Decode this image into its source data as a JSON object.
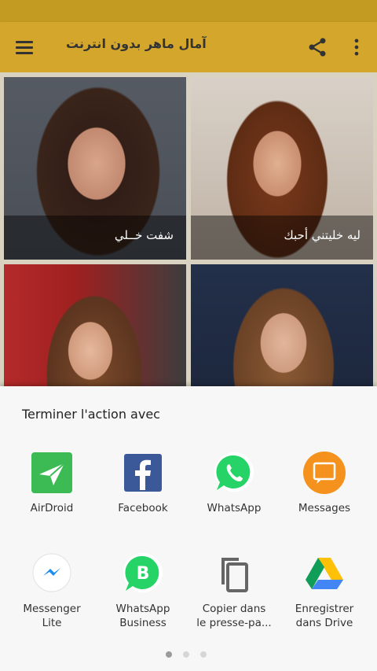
{
  "appbar": {
    "title": "آمال ماهر بدون انترنت",
    "icons": [
      "menu-icon",
      "share-icon",
      "more-vert-icon"
    ],
    "color": "#d4a72c"
  },
  "cards": [
    {
      "caption": "شفت خــلي"
    },
    {
      "caption": "ليه خليتني أحبك"
    },
    {
      "caption": ""
    },
    {
      "caption": ""
    }
  ],
  "share_sheet": {
    "title": "Terminer l'action avec",
    "apps": [
      {
        "label": "AirDroid",
        "icon": "airdroid-icon"
      },
      {
        "label": "Facebook",
        "icon": "facebook-icon"
      },
      {
        "label": "WhatsApp",
        "icon": "whatsapp-icon"
      },
      {
        "label": "Messages",
        "icon": "messages-icon"
      },
      {
        "label": "Messenger\nLite",
        "icon": "messenger-lite-icon"
      },
      {
        "label": "WhatsApp\nBusiness",
        "icon": "whatsapp-business-icon"
      },
      {
        "label": "Copier dans\nle presse-pa...",
        "icon": "copy-icon"
      },
      {
        "label": "Enregistrer\ndans Drive",
        "icon": "drive-icon"
      }
    ],
    "pages": 3,
    "active_page": 1
  }
}
